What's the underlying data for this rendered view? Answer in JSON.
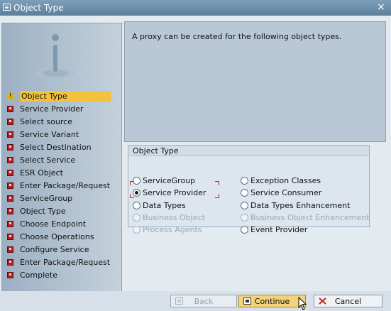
{
  "window": {
    "title": "Object Type",
    "close_glyph": "×"
  },
  "sidebar": {
    "items": [
      {
        "label": "Object Type",
        "icon": "warning-icon",
        "active": true
      },
      {
        "label": "Service Provider",
        "icon": "pending-step-icon"
      },
      {
        "label": "Select source",
        "icon": "pending-step-icon"
      },
      {
        "label": "Service Variant",
        "icon": "pending-step-icon"
      },
      {
        "label": "Select Destination",
        "icon": "pending-step-icon"
      },
      {
        "label": "Select Service",
        "icon": "pending-step-icon"
      },
      {
        "label": "ESR Object",
        "icon": "pending-step-icon"
      },
      {
        "label": "Enter Package/Request",
        "icon": "pending-step-icon"
      },
      {
        "label": "ServiceGroup",
        "icon": "pending-step-icon"
      },
      {
        "label": "Object Type",
        "icon": "pending-step-icon"
      },
      {
        "label": "Choose Endpoint",
        "icon": "pending-step-icon"
      },
      {
        "label": "Choose Operations",
        "icon": "pending-step-icon"
      },
      {
        "label": "Configure Service",
        "icon": "pending-step-icon"
      },
      {
        "label": "Enter Package/Request",
        "icon": "pending-step-icon"
      },
      {
        "label": "Complete",
        "icon": "pending-step-icon"
      }
    ]
  },
  "info": {
    "text": "A proxy can be created for the following object types."
  },
  "object_type": {
    "title": "Object Type",
    "options": [
      {
        "label": "ServiceGroup",
        "checked": false,
        "disabled": false
      },
      {
        "label": "Service Provider",
        "checked": true,
        "disabled": false
      },
      {
        "label": "Data Types",
        "checked": false,
        "disabled": false
      },
      {
        "label": "Business Object",
        "checked": false,
        "disabled": true
      },
      {
        "label": "Process Agents",
        "checked": false,
        "disabled": true
      },
      {
        "label": "Exception Classes",
        "checked": false,
        "disabled": false
      },
      {
        "label": "Service Consumer",
        "checked": false,
        "disabled": false
      },
      {
        "label": "Data Types Enhancement",
        "checked": false,
        "disabled": false
      },
      {
        "label": "Business Object Enhancement",
        "checked": false,
        "disabled": true
      },
      {
        "label": "Event Provider",
        "checked": false,
        "disabled": false
      }
    ]
  },
  "buttons": {
    "back": "Back",
    "continue": "Continue",
    "cancel": "Cancel"
  },
  "colors": {
    "active_step": "#f3c23a",
    "continue_button": "#f2d27a",
    "title_bar": "#6b8eab"
  }
}
